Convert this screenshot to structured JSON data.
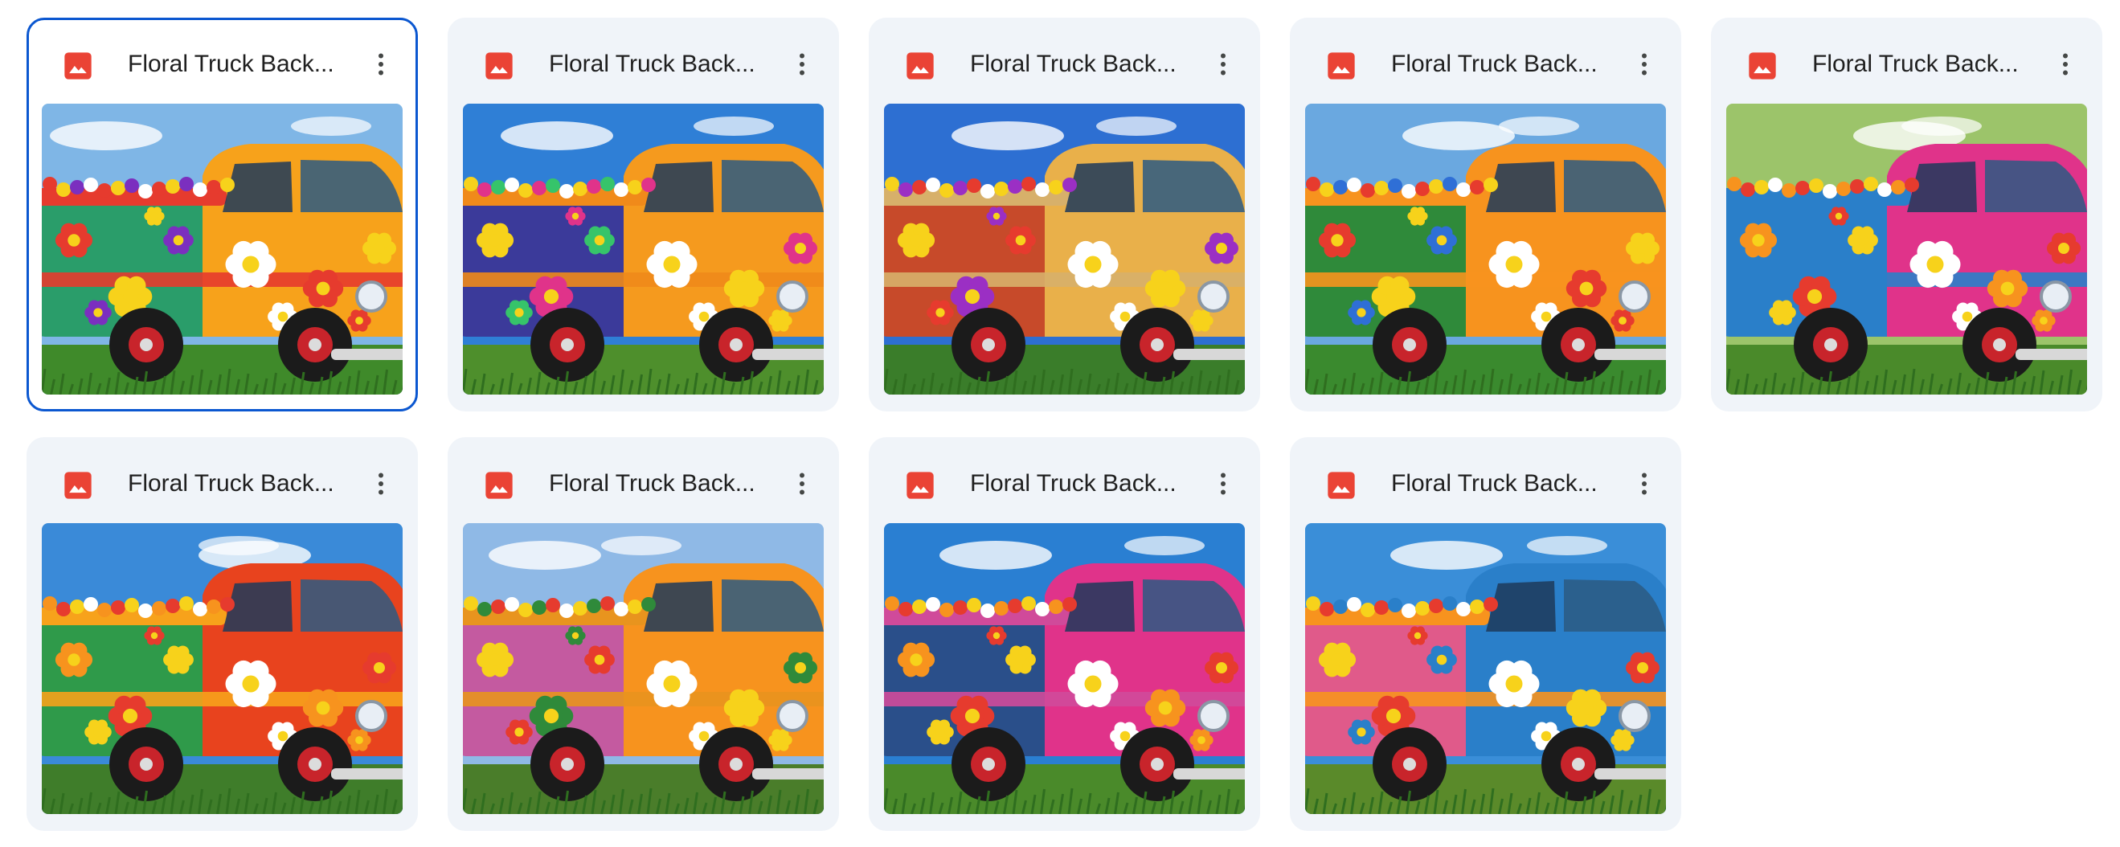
{
  "files": [
    {
      "name": "Floral Truck Back...",
      "selected": true,
      "thumbnail": {
        "sky": "#7fb6e6",
        "ground": "#3f8a2a",
        "body": "#2a9d6a",
        "accent": "#f7a21b",
        "roof": "#e63b2e",
        "flowers": [
          "#e63b2e",
          "#f7d21b",
          "#7b2fbf",
          "#ffffff"
        ]
      }
    },
    {
      "name": "Floral Truck Back...",
      "selected": false,
      "thumbnail": {
        "sky": "#2f7fd6",
        "ground": "#4e8f2c",
        "body": "#3b3a9a",
        "accent": "#f59a1e",
        "roof": "#f08a1a",
        "flowers": [
          "#f7d21b",
          "#e0338a",
          "#36c46a",
          "#ffffff"
        ]
      }
    },
    {
      "name": "Floral Truck Back...",
      "selected": false,
      "thumbnail": {
        "sky": "#2d6fd2",
        "ground": "#3a7d2a",
        "body": "#c74a2a",
        "accent": "#e9b04a",
        "roof": "#d7b06a",
        "flowers": [
          "#f7d21b",
          "#9b2fc4",
          "#e63b2e",
          "#ffffff"
        ]
      }
    },
    {
      "name": "Floral Truck Back...",
      "selected": false,
      "thumbnail": {
        "sky": "#6aa8e0",
        "ground": "#3a8a2e",
        "body": "#2f8a3a",
        "accent": "#f7931e",
        "roof": "#f7931e",
        "flowers": [
          "#e63b2e",
          "#f7d21b",
          "#2f6fd6",
          "#ffffff"
        ]
      }
    },
    {
      "name": "Floral Truck Back...",
      "selected": false,
      "thumbnail": {
        "sky": "#9cc46a",
        "ground": "#4a8a2a",
        "body": "#2a7fc9",
        "accent": "#e0338a",
        "roof": "#2a7fc9",
        "flowers": [
          "#f7931e",
          "#e63b2e",
          "#f7d21b",
          "#ffffff"
        ]
      }
    },
    {
      "name": "Floral Truck Back...",
      "selected": false,
      "thumbnail": {
        "sky": "#3a8ad8",
        "ground": "#3f7d2a",
        "body": "#2f9a4a",
        "accent": "#e8431e",
        "roof": "#f7a21b",
        "flowers": [
          "#f7931e",
          "#e63b2e",
          "#f7d21b",
          "#ffffff"
        ]
      }
    },
    {
      "name": "Floral Truck Back...",
      "selected": false,
      "thumbnail": {
        "sky": "#8fb9e6",
        "ground": "#4a7d2a",
        "body": "#c45aa0",
        "accent": "#f7931e",
        "roof": "#e8941e",
        "flowers": [
          "#f7d21b",
          "#2f8a3a",
          "#e63b2e",
          "#ffffff"
        ]
      }
    },
    {
      "name": "Floral Truck Back...",
      "selected": false,
      "thumbnail": {
        "sky": "#2a7fd2",
        "ground": "#4a8a2a",
        "body": "#2a4f8a",
        "accent": "#e0338a",
        "roof": "#d04a9a",
        "flowers": [
          "#f7931e",
          "#e63b2e",
          "#f7d21b",
          "#ffffff"
        ]
      }
    },
    {
      "name": "Floral Truck Back...",
      "selected": false,
      "thumbnail": {
        "sky": "#3a8ed8",
        "ground": "#5a8a2a",
        "body": "#e05a8a",
        "accent": "#2a7fc9",
        "roof": "#f7931e",
        "flowers": [
          "#f7d21b",
          "#e63b2e",
          "#2a7fc9",
          "#ffffff"
        ]
      }
    }
  ],
  "icons": {
    "file_type": "image-file-icon",
    "more": "more-vert-icon"
  },
  "colors": {
    "file_icon": "#ea4335",
    "selection_border": "#0b57d0",
    "card_background": "#f0f4f9",
    "text": "#1f1f1f",
    "more_icon": "#444746"
  }
}
